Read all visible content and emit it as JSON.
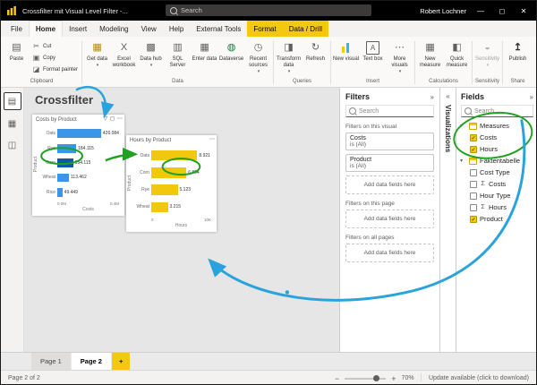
{
  "colors": {
    "accent_yellow": "#F2C811",
    "bar_blue": "#3D95E8",
    "bar_blue_selected": "#1159A6",
    "bar_yellow": "#F2C80F",
    "annotation_green": "#21A121",
    "annotation_blue": "#2AA3DC"
  },
  "icon_glyphs": {
    "paste": "▤",
    "cut": "✂",
    "copy": "▣",
    "format-painter": "◪",
    "get-data": "▦",
    "excel-workbook": "X",
    "data-hub": "▩",
    "sql-server": "▥",
    "enter-data": "▦",
    "dataverse": "◍",
    "recent-sources": "◷",
    "transform-data": "◨",
    "refresh": "↻",
    "new-visual": "",
    "text-box": "A",
    "more-visuals": "⋯",
    "new-measure": "▦",
    "quick-measure": "◧",
    "sensitivity": "◒",
    "publish": "↥",
    "report-view": "▤",
    "data-view": "▦",
    "model-view": "◫",
    "funnel": "▽",
    "focus": "◻",
    "more": "⋯",
    "minimize": "—",
    "maximize": "◻",
    "close": "✕",
    "collapse": "»",
    "expand": "«",
    "chevron-down": "▾",
    "check": "✓",
    "sigma": "Σ",
    "zoom-in": "+",
    "zoom-out": "−",
    "divider": "│"
  },
  "titlebar": {
    "title": "Crossfilter mit Visual Level Filter -...",
    "search_placeholder": "Search",
    "user": "Robert Lochner"
  },
  "menu": {
    "tabs": [
      {
        "label": "File"
      },
      {
        "label": "Home",
        "selected": true
      },
      {
        "label": "Insert"
      },
      {
        "label": "Modeling"
      },
      {
        "label": "View"
      },
      {
        "label": "Help"
      },
      {
        "label": "External Tools"
      },
      {
        "label": "Format",
        "accent": true
      },
      {
        "label": "Data / Drill",
        "accent": true
      }
    ]
  },
  "ribbon": {
    "groups": [
      {
        "label": "Clipboard",
        "buttons": [
          {
            "label": "Paste",
            "icon": "paste",
            "size": "big"
          },
          {
            "label": "Cut",
            "icon": "cut",
            "size": "small"
          },
          {
            "label": "Copy",
            "icon": "copy",
            "size": "small"
          },
          {
            "label": "Format painter",
            "icon": "format-painter",
            "size": "small"
          }
        ]
      },
      {
        "label": "Data",
        "buttons": [
          {
            "label": "Get data",
            "icon": "get-data",
            "size": "big",
            "caret": true
          },
          {
            "label": "Excel workbook",
            "icon": "excel-workbook",
            "size": "big"
          },
          {
            "label": "Data hub",
            "icon": "data-hub",
            "size": "big",
            "caret": true
          },
          {
            "label": "SQL Server",
            "icon": "sql-server",
            "size": "big"
          },
          {
            "label": "Enter data",
            "icon": "enter-data",
            "size": "big"
          },
          {
            "label": "Dataverse",
            "icon": "dataverse",
            "size": "big"
          },
          {
            "label": "Recent sources",
            "icon": "recent-sources",
            "size": "big",
            "caret": true
          }
        ]
      },
      {
        "label": "Queries",
        "buttons": [
          {
            "label": "Transform data",
            "icon": "transform-data",
            "size": "big",
            "caret": true
          },
          {
            "label": "Refresh",
            "icon": "refresh",
            "size": "big"
          }
        ]
      },
      {
        "label": "Insert",
        "buttons": [
          {
            "label": "New visual",
            "icon": "new-visual",
            "size": "big"
          },
          {
            "label": "Text box",
            "icon": "text-box",
            "size": "big"
          },
          {
            "label": "More visuals",
            "icon": "more-visuals",
            "size": "big",
            "caret": true
          }
        ]
      },
      {
        "label": "Calculations",
        "buttons": [
          {
            "label": "New measure",
            "icon": "new-measure",
            "size": "big"
          },
          {
            "label": "Quick measure",
            "icon": "quick-measure",
            "size": "big"
          }
        ]
      },
      {
        "label": "Sensitivity",
        "buttons": [
          {
            "label": "Sensitivity",
            "icon": "sensitivity",
            "size": "big",
            "caret": true,
            "disabled": true
          }
        ]
      },
      {
        "label": "Share",
        "buttons": [
          {
            "label": "Publish",
            "icon": "publish",
            "size": "big"
          }
        ]
      }
    ]
  },
  "rail": {
    "items": [
      {
        "name": "report-view",
        "icon": "report-view",
        "selected": true
      },
      {
        "name": "data-view",
        "icon": "data-view"
      },
      {
        "name": "model-view",
        "icon": "model-view"
      }
    ]
  },
  "canvas": {
    "page_title": "Crossfilter"
  },
  "chart_data": [
    {
      "type": "bar",
      "orientation": "horizontal",
      "title": "Costs by Product",
      "categories": [
        "Oats",
        "Rye",
        "Corn",
        "Wheat",
        "Rice"
      ],
      "values": [
        426084,
        184115,
        154115,
        113462,
        49449
      ],
      "value_labels": [
        "426.084",
        "184.115",
        "154.115",
        "113.462",
        "49.449"
      ],
      "bar_colors": [
        "#3D95E8",
        "#3D95E8",
        "#1159A6",
        "#3D95E8",
        "#3D95E8"
      ],
      "xlabel": "Costs",
      "ylabel": "Product",
      "x_ticks": [
        "0.0M",
        "0.4M"
      ],
      "xmax": 610000
    },
    {
      "type": "bar",
      "orientation": "horizontal",
      "title": "Hours by Product",
      "categories": [
        "Oats",
        "Corn",
        "Rye",
        "Wheat"
      ],
      "values": [
        8921,
        6804,
        5123,
        3215
      ],
      "value_labels": [
        "8.921",
        "6.804",
        "5.123",
        "3.215"
      ],
      "color": "#F2C80F",
      "xlabel": "Hours",
      "ylabel": "Product",
      "x_ticks": [
        "0",
        "10K"
      ],
      "xmax": 11800
    }
  ],
  "filters": {
    "title": "Filters",
    "search_placeholder": "Search",
    "sections": [
      {
        "label": "Filters on this visual",
        "cards": [
          {
            "field": "Costs",
            "condition": "is (All)"
          },
          {
            "field": "Product",
            "condition": "is (All)"
          }
        ],
        "add_label": "Add data fields here"
      },
      {
        "label": "Filters on this page",
        "cards": [],
        "add_label": "Add data fields here"
      },
      {
        "label": "Filters on all pages",
        "cards": [],
        "add_label": "Add data fields here"
      }
    ]
  },
  "visualizations": {
    "title": "Visualizations"
  },
  "fields": {
    "title": "Fields",
    "search_placeholder": "Search",
    "tree": [
      {
        "label": "Measures",
        "type": "group",
        "expanded": true
      },
      {
        "label": "Costs",
        "type": "field",
        "checked": true,
        "indent": 1
      },
      {
        "label": "Hours",
        "type": "field",
        "checked": true,
        "indent": 1
      },
      {
        "label": "Faktentabelle",
        "type": "group",
        "expanded": true
      },
      {
        "label": "Cost Type",
        "type": "field",
        "checked": false,
        "indent": 1
      },
      {
        "label": "Costs",
        "type": "field",
        "checked": false,
        "indent": 1,
        "agg": true
      },
      {
        "label": "Hour Type",
        "type": "field",
        "checked": false,
        "indent": 1
      },
      {
        "label": "Hours",
        "type": "field",
        "checked": false,
        "indent": 1,
        "agg": true
      },
      {
        "label": "Product",
        "type": "field",
        "checked": true,
        "indent": 1
      }
    ]
  },
  "pages": {
    "tabs": [
      {
        "label": "Page 1"
      },
      {
        "label": "Page 2",
        "active": true
      }
    ],
    "add_button": "+"
  },
  "status": {
    "page_indicator": "Page 2 of 2",
    "zoom": "70%",
    "update_text": "Update available (click to download)"
  }
}
